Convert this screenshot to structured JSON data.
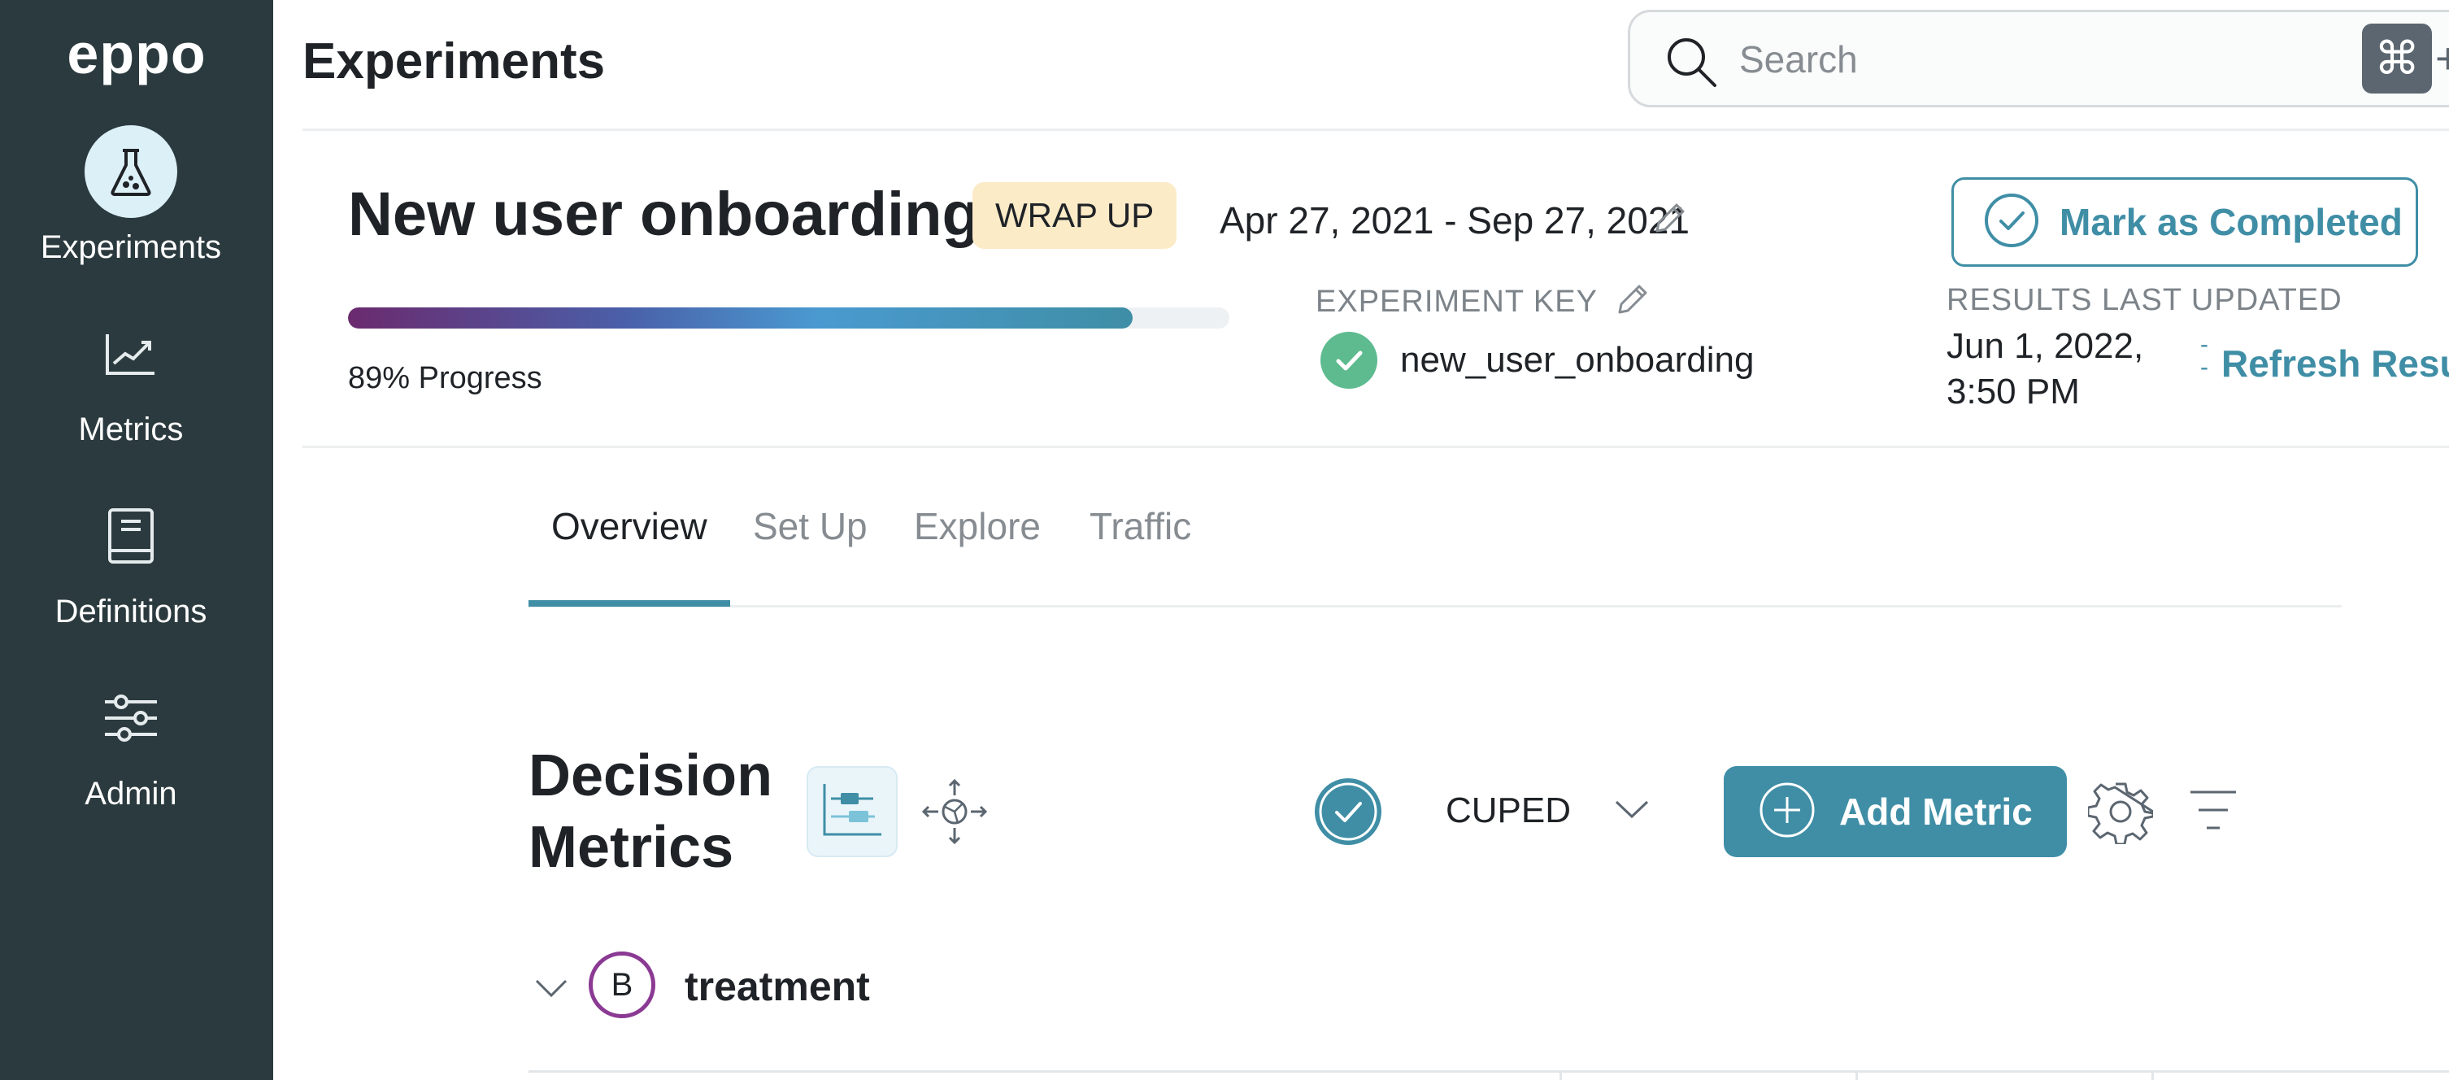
{
  "app": {
    "logo": "eppo"
  },
  "sidebar": {
    "items": [
      {
        "label": "Experiments",
        "icon": "flask-icon",
        "active": true
      },
      {
        "label": "Metrics",
        "icon": "chart-trend-icon",
        "active": false
      },
      {
        "label": "Definitions",
        "icon": "book-icon",
        "active": false
      },
      {
        "label": "Admin",
        "icon": "sliders-icon",
        "active": false
      }
    ]
  },
  "header": {
    "title": "Experiments",
    "search": {
      "placeholder": "Search",
      "shortcut_key": "⌘",
      "shortcut_plus": "+"
    }
  },
  "experiment": {
    "name": "New user onboarding",
    "status": "WRAP UP",
    "date_range": "Apr 27, 2021 - Sep 27, 2021",
    "progress": {
      "value": 89,
      "label": "89% Progress"
    },
    "key_label": "EXPERIMENT KEY",
    "key_value": "new_user_onboarding",
    "results_label": "RESULTS LAST UPDATED",
    "results_date_line1": "Jun 1, 2022,",
    "results_date_line2": "3:50 PM",
    "refresh_label": "Refresh Resu",
    "mark_completed_label": "Mark as Completed"
  },
  "tabs": [
    {
      "label": "Overview",
      "active": true
    },
    {
      "label": "Set Up",
      "active": false
    },
    {
      "label": "Explore",
      "active": false
    },
    {
      "label": "Traffic",
      "active": false
    }
  ],
  "decision_metrics": {
    "title_line1": "Decision",
    "title_line2": "Metrics",
    "cuped_label": "CUPED",
    "add_metric_label": "Add Metric"
  },
  "variant": {
    "badge": "B",
    "name": "treatment"
  },
  "colors": {
    "sidebar_bg": "#2b3a3e",
    "accent": "#3f8ea6",
    "badge_bg": "#fcebc7",
    "variant_ring": "#8b3a93",
    "success": "#5dbb8f"
  }
}
